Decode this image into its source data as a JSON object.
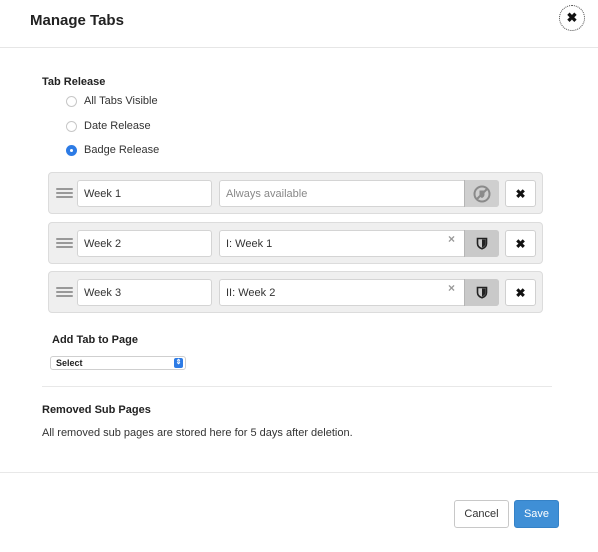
{
  "dialog": {
    "title": "Manage Tabs",
    "close_glyph": "✖"
  },
  "tab_release": {
    "label": "Tab Release",
    "options": [
      {
        "label": "All Tabs Visible",
        "checked": false
      },
      {
        "label": "Date Release",
        "checked": false
      },
      {
        "label": "Badge Release",
        "checked": true
      }
    ]
  },
  "tabs": [
    {
      "name": "Week 1",
      "release_value": "Always available",
      "is_placeholder": true,
      "badge_icon": "no-badge-icon",
      "remove_glyph": "✖"
    },
    {
      "name": "Week 2",
      "release_value": "I: Week 1",
      "is_placeholder": false,
      "clear_glyph": "×",
      "badge_icon": "shield-icon",
      "remove_glyph": "✖"
    },
    {
      "name": "Week 3",
      "release_value": "II: Week 2",
      "is_placeholder": false,
      "clear_glyph": "×",
      "badge_icon": "shield-icon",
      "remove_glyph": "✖"
    }
  ],
  "add_tab": {
    "label": "Add Tab to Page",
    "select_value": "Select",
    "caret_glyph": "⇕"
  },
  "removed": {
    "label": "Removed Sub Pages",
    "description": "All removed sub pages are stored here for 5 days after deletion."
  },
  "footer": {
    "cancel_label": "Cancel",
    "save_label": "Save"
  },
  "colors": {
    "accent": "#2d7be5",
    "save_button": "#3f8fd6",
    "row_background": "#efefef"
  }
}
